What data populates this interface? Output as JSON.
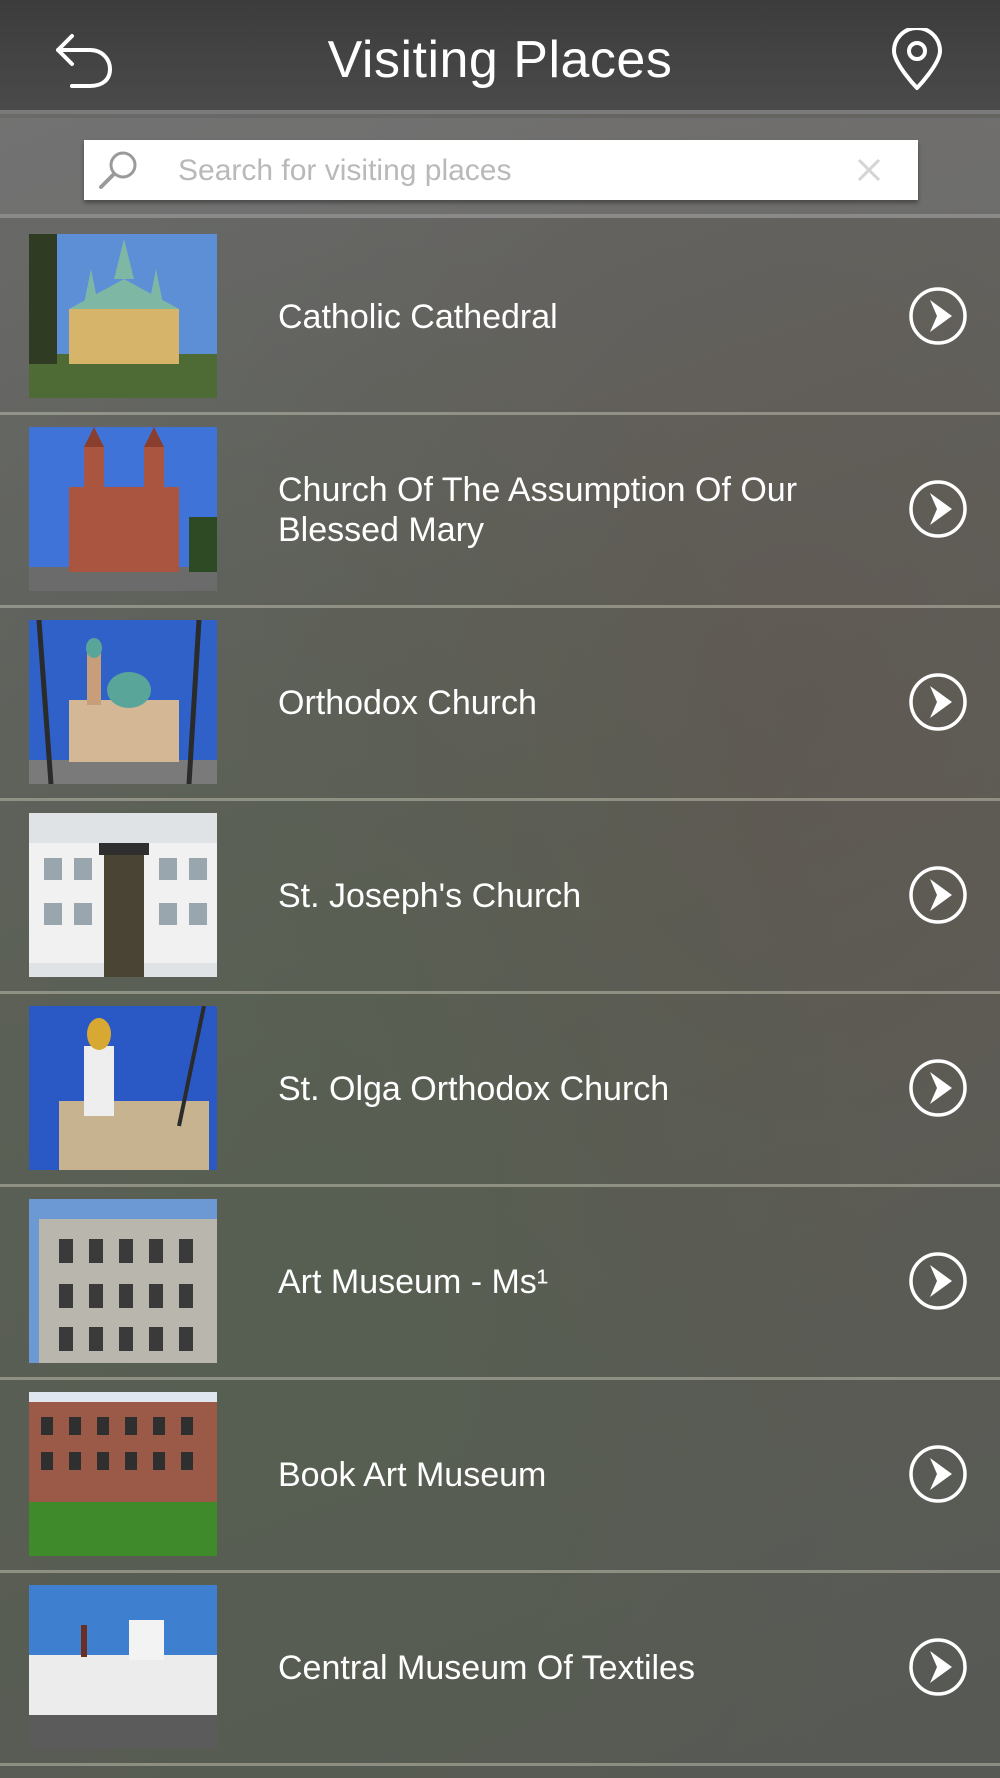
{
  "header": {
    "title": "Visiting Places",
    "back_icon": "back-arrow-icon",
    "map_icon": "map-pin-icon"
  },
  "search": {
    "placeholder": "Search for visiting places",
    "value": ""
  },
  "places": [
    {
      "name": "Catholic Cathedral",
      "thumb": "gothic-cathedral"
    },
    {
      "name": "Church Of The Assumption Of Our Blessed Mary",
      "thumb": "red-brick-church"
    },
    {
      "name": "Orthodox Church",
      "thumb": "domed-church"
    },
    {
      "name": "St. Joseph's Church",
      "thumb": "statue-in-snow"
    },
    {
      "name": "St. Olga Orthodox Church",
      "thumb": "golden-dome-church"
    },
    {
      "name": "Art Museum - Ms¹",
      "thumb": "stone-palace"
    },
    {
      "name": "Book Art Museum",
      "thumb": "brick-building"
    },
    {
      "name": "Central Museum Of Textiles",
      "thumb": "white-factory"
    }
  ],
  "colors": {
    "header_bg": "#3c3c3c",
    "row_divider": "#b9b9aa",
    "text": "#ffffff"
  }
}
